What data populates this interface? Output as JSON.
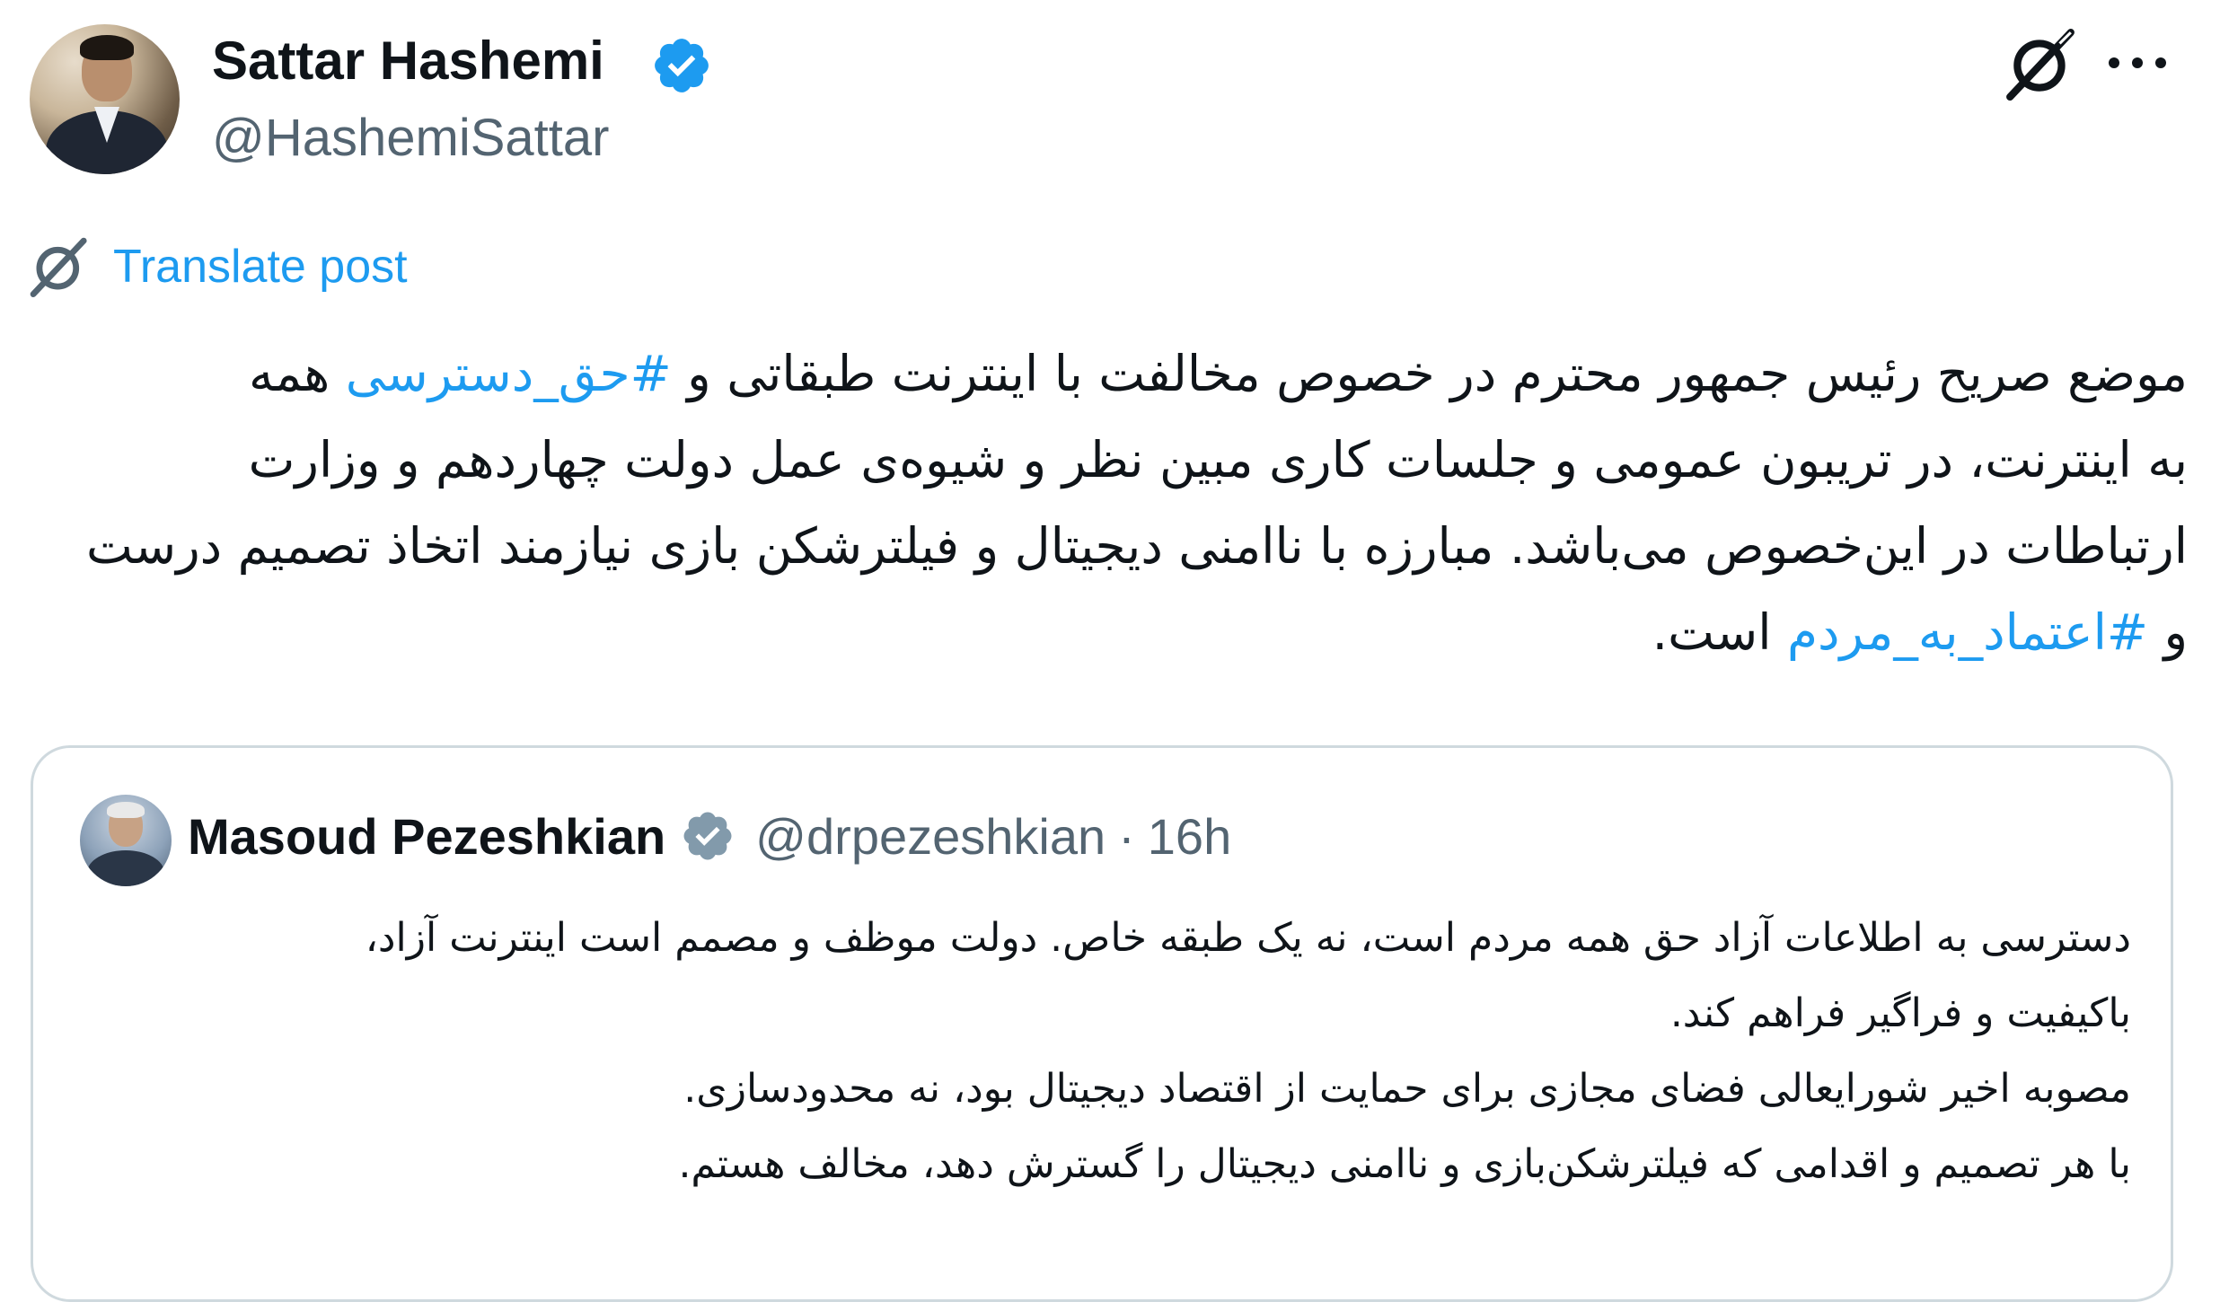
{
  "author": {
    "display_name": "Sattar Hashemi",
    "handle": "@HashemiSattar",
    "verified": true,
    "avatar": "profile-photo"
  },
  "header_actions": {
    "grok_icon": "grok-icon",
    "more_icon": "more-horizontal-icon"
  },
  "translate": {
    "icon": "grok-translate-icon",
    "label": "Translate post"
  },
  "post": {
    "line1_text": "موضع صریح رئیس جمهور محترم در خصوص مخالفت با اینترنت طبقاتی و",
    "line1_hashtag": "#حق_دسترسی",
    "line1_tail": "همه",
    "line2": "به اینترنت، در تریبون عمومی و جلسات کاری مبین نظر و شیوه‌ی عمل دولت چهاردهم و وزارت",
    "line3": "ارتباطات در این‌خصوص می‌باشد. مبارزه با ناامنی دیجیتال و فیلترشکن بازی نیازمند اتخاذ تصمیم درست",
    "line4_start": "و",
    "line4_hashtag": "#اعتماد_به_مردم",
    "line4_end": "است."
  },
  "quoted_post": {
    "display_name": "Masoud Pezeshkian",
    "verified": true,
    "verified_color": "#829aab",
    "handle": "@drpezeshkian",
    "separator": "·",
    "time": "16h",
    "lines": [
      "دسترسی به اطلاعات آزاد حق همه مردم است، نه یک طبقه خاص. دولت موظف و مصمم است اینترنت آزاد،",
      "باکیفیت و فراگیر فراهم کند.",
      "مصوبه اخیر شورایعالی فضای مجازی برای حمایت از اقتصاد دیجیتال بود، نه محدودسازی.",
      "با هر تصمیم و اقدامی که فیلترشکن‌بازی و ناامنی دیجیتال را گسترش دهد، مخالف هستم."
    ]
  },
  "colors": {
    "link": "#1d9bf0",
    "text": "#0f1419",
    "secondary": "#536471",
    "border": "#cfd9de",
    "verified_blue": "#1d9bf0"
  }
}
